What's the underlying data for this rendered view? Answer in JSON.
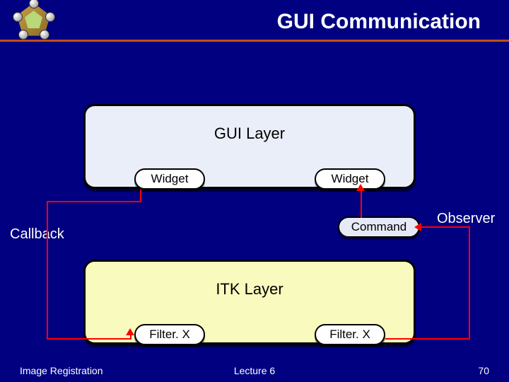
{
  "slide": {
    "title": "GUI Communication",
    "gui_layer_title": "GUI Layer",
    "itk_layer_title": "ITK Layer",
    "widget_left": "Widget",
    "widget_right": "Widget",
    "filter_left": "Filter. X",
    "filter_right": "Filter. X",
    "command": "Command",
    "callback": "Callback",
    "observer": "Observer"
  },
  "footer": {
    "left": "Image Registration",
    "center": "Lecture 6",
    "page": "70"
  }
}
